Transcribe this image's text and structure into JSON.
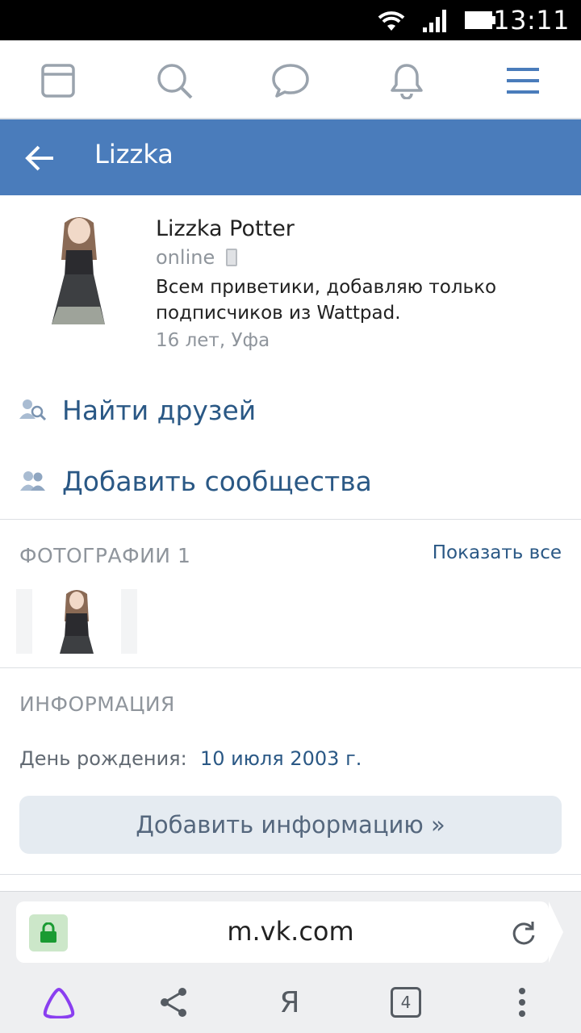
{
  "status_bar": {
    "time": "13:11",
    "icons": [
      "wifi-icon",
      "signal-icon",
      "battery-icon"
    ]
  },
  "top_nav": {
    "icons": [
      "news-icon",
      "search-icon",
      "messages-icon",
      "notifications-icon",
      "menu-icon"
    ],
    "accent": "#4a7cbb"
  },
  "header": {
    "title": "Lizzka",
    "bg_color": "#4a7cbb"
  },
  "profile": {
    "name": "Lizzka Potter",
    "online": "online",
    "status": "Всем приветики, добавляю только подписчиков из Wattpad.",
    "meta": "16 лет, Уфа"
  },
  "actions": {
    "find_friends": "Найти друзей",
    "add_communities": "Добавить сообщества"
  },
  "photos": {
    "title": "ФОТОГРАФИИ 1",
    "show_all": "Показать все"
  },
  "info": {
    "title": "ИНФОРМАЦИЯ",
    "birthday_label": "День рождения:",
    "birthday_value": "10 июля 2003 г.",
    "add_button": "Добавить информацию »"
  },
  "browser": {
    "url": "m.vk.com",
    "tabs_count": "4",
    "yandex_label": "Я"
  }
}
